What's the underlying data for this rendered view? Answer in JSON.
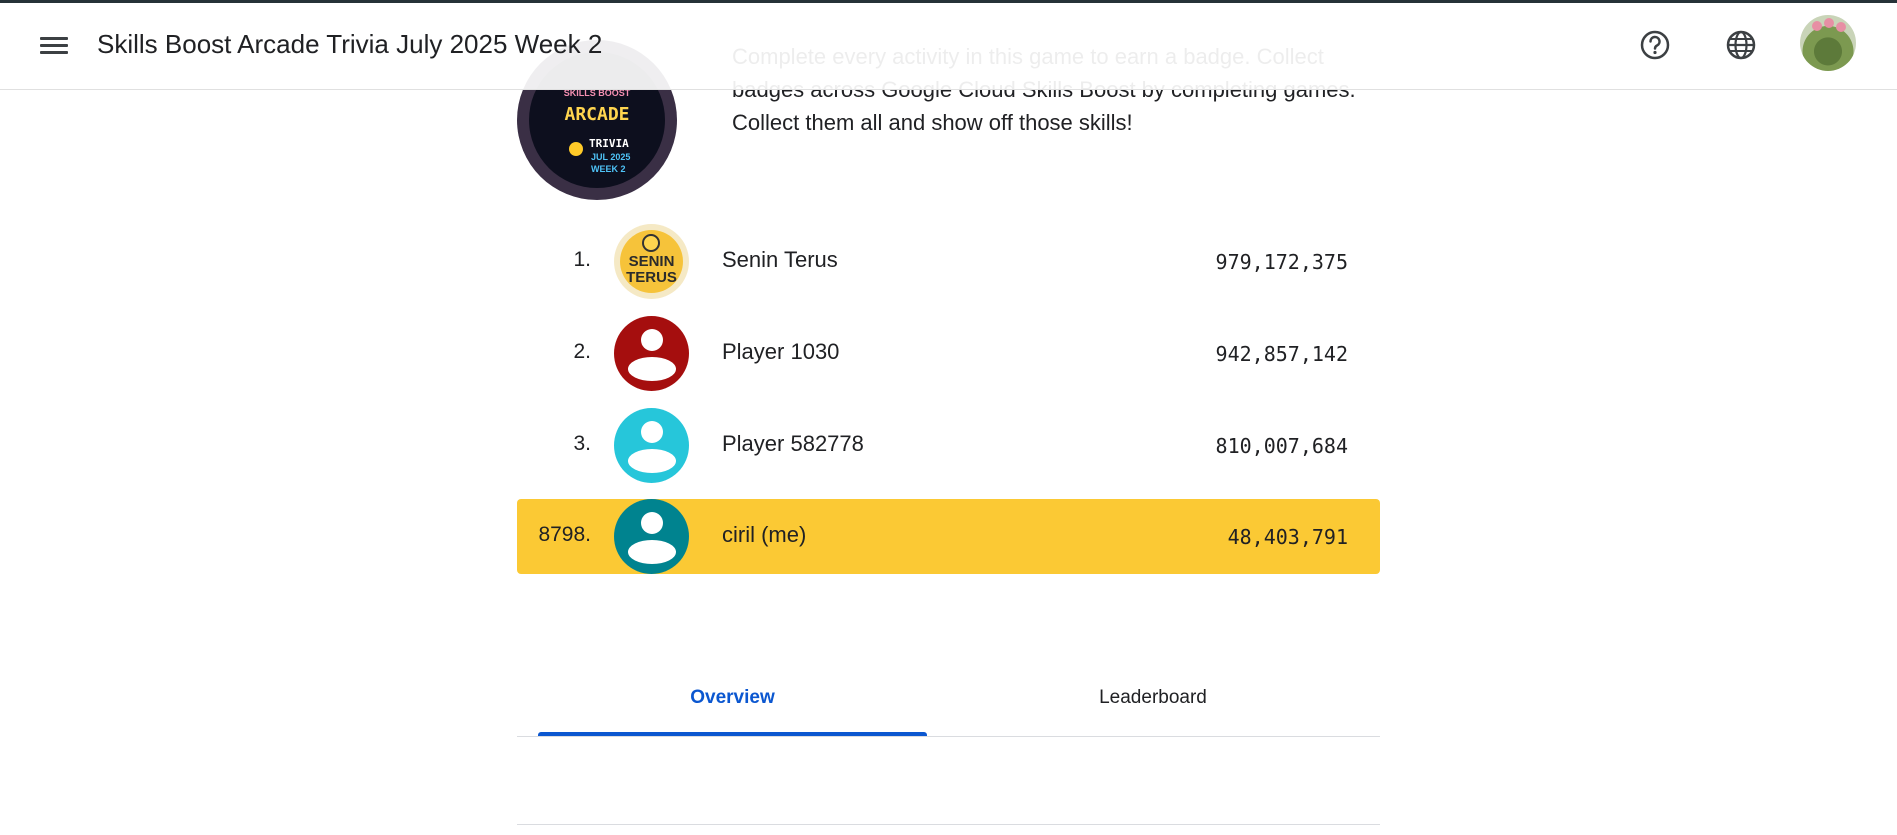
{
  "header": {
    "title": "Skills Boost Arcade Trivia July 2025 Week 2",
    "icons": {
      "menu": "menu-icon",
      "help": "help-icon",
      "language": "globe-icon",
      "account": "avatar"
    }
  },
  "badge": {
    "line1": "SKILLS BOOST",
    "line2": "ARCADE",
    "line3": "TRIVIA",
    "line4": "JUL 2025",
    "line5": "WEEK 2"
  },
  "description": "Complete every activity in this game to earn a badge. Collect badges across Google Cloud Skills Boost by completing games. Collect them all and show off those skills!",
  "leaderboard": [
    {
      "rank": "1.",
      "name": "Senin Terus",
      "score": "979,172,375",
      "avatar_text": "SENIN TERUS",
      "avatar_color": "#f6c33a"
    },
    {
      "rank": "2.",
      "name": "Player 1030",
      "score": "942,857,142",
      "avatar_color": "#a50e0e"
    },
    {
      "rank": "3.",
      "name": "Player 582778",
      "score": "810,007,684",
      "avatar_color": "#26c6da"
    },
    {
      "rank": "8798.",
      "name": "ciril (me)",
      "score": "48,403,791",
      "avatar_color": "#00838f",
      "highlight_color": "#fbc934"
    }
  ],
  "tabs": [
    {
      "label": "Overview",
      "active": true
    },
    {
      "label": "Leaderboard",
      "active": false
    }
  ],
  "colors": {
    "accent": "#0b57d0",
    "highlight": "#fbc934"
  }
}
